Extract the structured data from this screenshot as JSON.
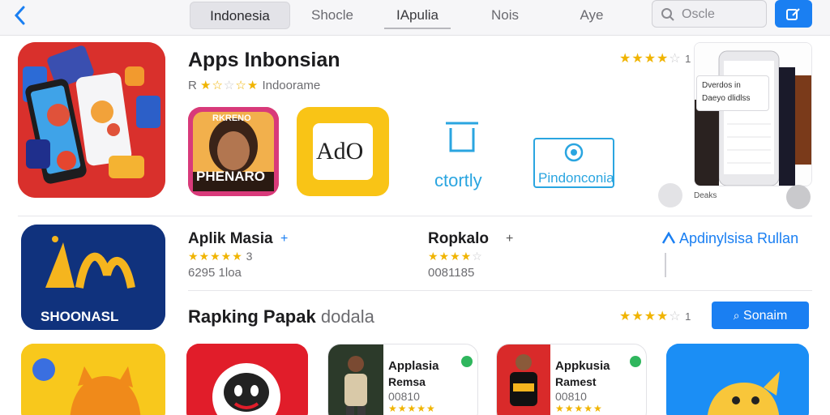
{
  "header": {
    "tabs": [
      {
        "label": "Indonesia"
      },
      {
        "label": "Shocle"
      },
      {
        "label": "IАpulia"
      },
      {
        "label": "Nois"
      },
      {
        "label": "Aye"
      }
    ],
    "search_placeholder": "Oscle",
    "back_icon": "chevron-left-icon",
    "compose_icon": "compose-icon"
  },
  "featured": {
    "title": "Apps Inbonsian",
    "subtitle": "Indoorame",
    "sub_prefix": "R",
    "rating_stars": 4,
    "rating_count": "1",
    "tiles": [
      {
        "label": "PHENARO",
        "top_label": "RKRENO"
      },
      {
        "label": "AdO"
      },
      {
        "label": "ctortly"
      },
      {
        "label": "Pindonconia"
      }
    ],
    "phone_caption_1": "Dverdos in",
    "phone_caption_2": "Daeyo dlidlss",
    "phone_footer": "Deaks"
  },
  "apps_row": [
    {
      "name": "Aplik Masia",
      "plus": "+",
      "stars": 5,
      "rating": "3",
      "meta": "6295 1loa",
      "icon_text": "SHOONASL"
    },
    {
      "name": "Ropkalo",
      "plus": "+",
      "stars": 4,
      "rating": "",
      "meta": "0081185"
    }
  ],
  "link": {
    "label": "Apdinylsisa Rullan",
    "icon": "link-icon"
  },
  "section2": {
    "title": "Rapking Papak",
    "title_light": "dodala",
    "rating_stars": 4,
    "rating_count": "1",
    "button": "Sonaim"
  },
  "cards": [
    {
      "title": "",
      "sub": ""
    },
    {
      "title": "",
      "sub": ""
    },
    {
      "title": "Applasia",
      "sub": "Remsa",
      "meta": "00810"
    },
    {
      "title": "Appkusia",
      "sub": "Ramest",
      "meta": "00810"
    },
    {
      "title": "",
      "sub": ""
    }
  ],
  "colors": {
    "accent": "#1a7ff2",
    "star": "#f0b400",
    "feature_red": "#d9302c"
  }
}
